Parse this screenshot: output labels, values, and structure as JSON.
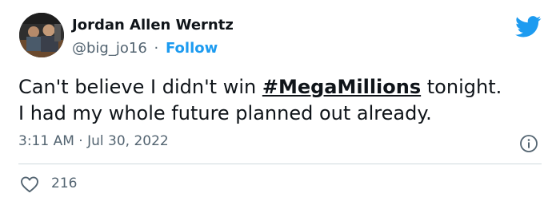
{
  "tweet": {
    "author": {
      "name": "Jordan Allen Werntz",
      "handle": "@big_jo16",
      "separator": "·",
      "follow_label": "Follow"
    },
    "text_before": "Can't believe I didn't win ",
    "hashtag": "#MegaMillions",
    "text_after": " tonight.",
    "text_line2": "I had my whole future planned out already.",
    "time": "3:11 AM",
    "date_separator": "·",
    "date": "Jul 30, 2022",
    "likes": "216"
  },
  "icons": {
    "brand": "twitter-bird-icon",
    "info": "info-icon",
    "like": "heart-icon"
  },
  "colors": {
    "text": "#0f1419",
    "secondary": "#536471",
    "accent": "#1d9bf0",
    "divider": "#cfd9de"
  }
}
